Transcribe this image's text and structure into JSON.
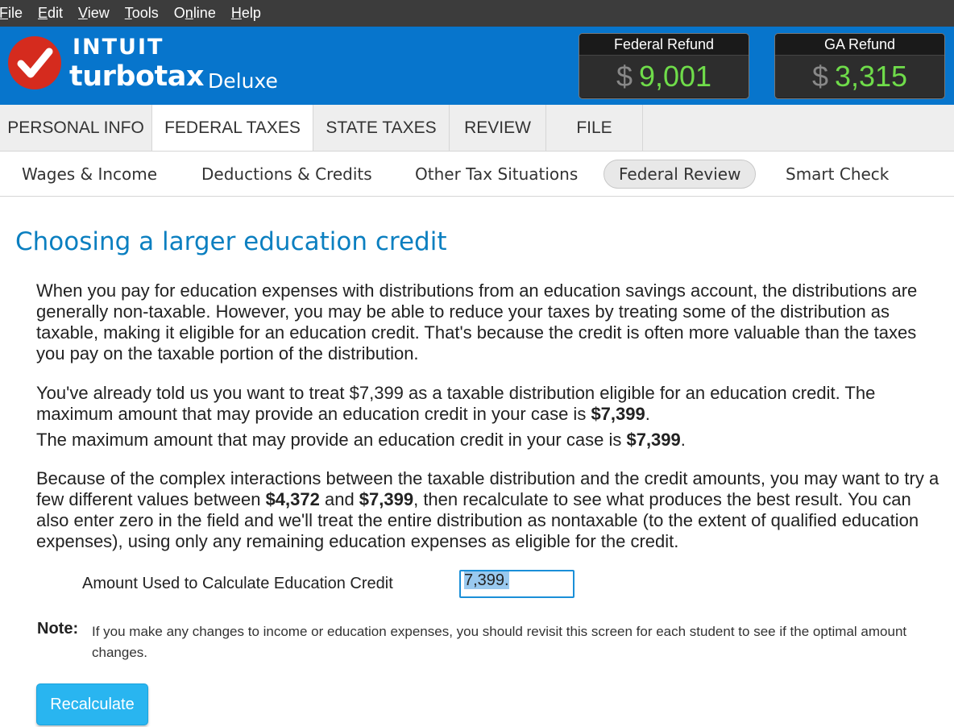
{
  "menu": [
    {
      "accel": "F",
      "rest": "ile"
    },
    {
      "accel": "E",
      "rest": "dit"
    },
    {
      "accel": "V",
      "rest": "iew"
    },
    {
      "accel": "T",
      "rest": "ools"
    },
    {
      "pre": "O",
      "accel": "n",
      "rest": "line"
    },
    {
      "accel": "H",
      "rest": "elp"
    }
  ],
  "brand": {
    "intuit": "INTUIT",
    "turbotax": "turbotax",
    "edition": "Deluxe"
  },
  "refunds": {
    "federal": {
      "label": "Federal Refund",
      "currency": "$",
      "amount": "9,001"
    },
    "state": {
      "label": "GA Refund",
      "currency": "$",
      "amount": "3,315"
    }
  },
  "tabs": [
    "PERSONAL INFO",
    "FEDERAL TAXES",
    "STATE TAXES",
    "REVIEW",
    "FILE"
  ],
  "active_tab": "FEDERAL TAXES",
  "subnav": [
    "Wages & Income",
    "Deductions & Credits",
    "Other Tax Situations",
    "Federal Review",
    "Smart Check"
  ],
  "active_subnav": "Federal Review",
  "content": {
    "title": "Choosing a larger education credit",
    "p1": "When you pay for education expenses with distributions from an education savings account, the distributions are generally non-taxable. However, you may be able to reduce your taxes by treating some of the distribution as taxable, making it eligible for an education credit. That's because the credit is often more valuable than the taxes you pay on the taxable portion of the distribution.",
    "p2a": "You've already told us you want to treat $7,399 as a taxable distribution eligible for an education credit. The maximum amount that may provide an education credit in your case is ",
    "p2a_bold": "$7,399",
    "p2b": "The maximum amount that may provide an education credit in your case is ",
    "p2b_bold": "$7,399",
    "period": ".",
    "p3_1": "Because of the complex interactions between the taxable distribution and the credit amounts, you may want to try a few different values between ",
    "p3_min": "$4,372",
    "p3_and": " and ",
    "p3_max": "$7,399",
    "p3_2": ", then recalculate to see what produces the best result. You can also enter zero in the field and we'll treat the entire distribution as nontaxable (to the extent of qualified education expenses), using only any remaining education expenses as eligible for the credit.",
    "field_label": "Amount Used to Calculate Education Credit",
    "field_value": "7,399.",
    "note_label": "Note:",
    "note_text": "If you make any changes to income or education expenses, you should revisit this screen for each student to see if the optimal amount changes.",
    "button": "Recalculate"
  },
  "colors": {
    "header": "#0775cc",
    "menubar": "#3c3c3c",
    "title": "#0b7fc0",
    "refund_value": "#6fdc4a",
    "button": "#29b5f0",
    "logo": "#d52b1e"
  }
}
